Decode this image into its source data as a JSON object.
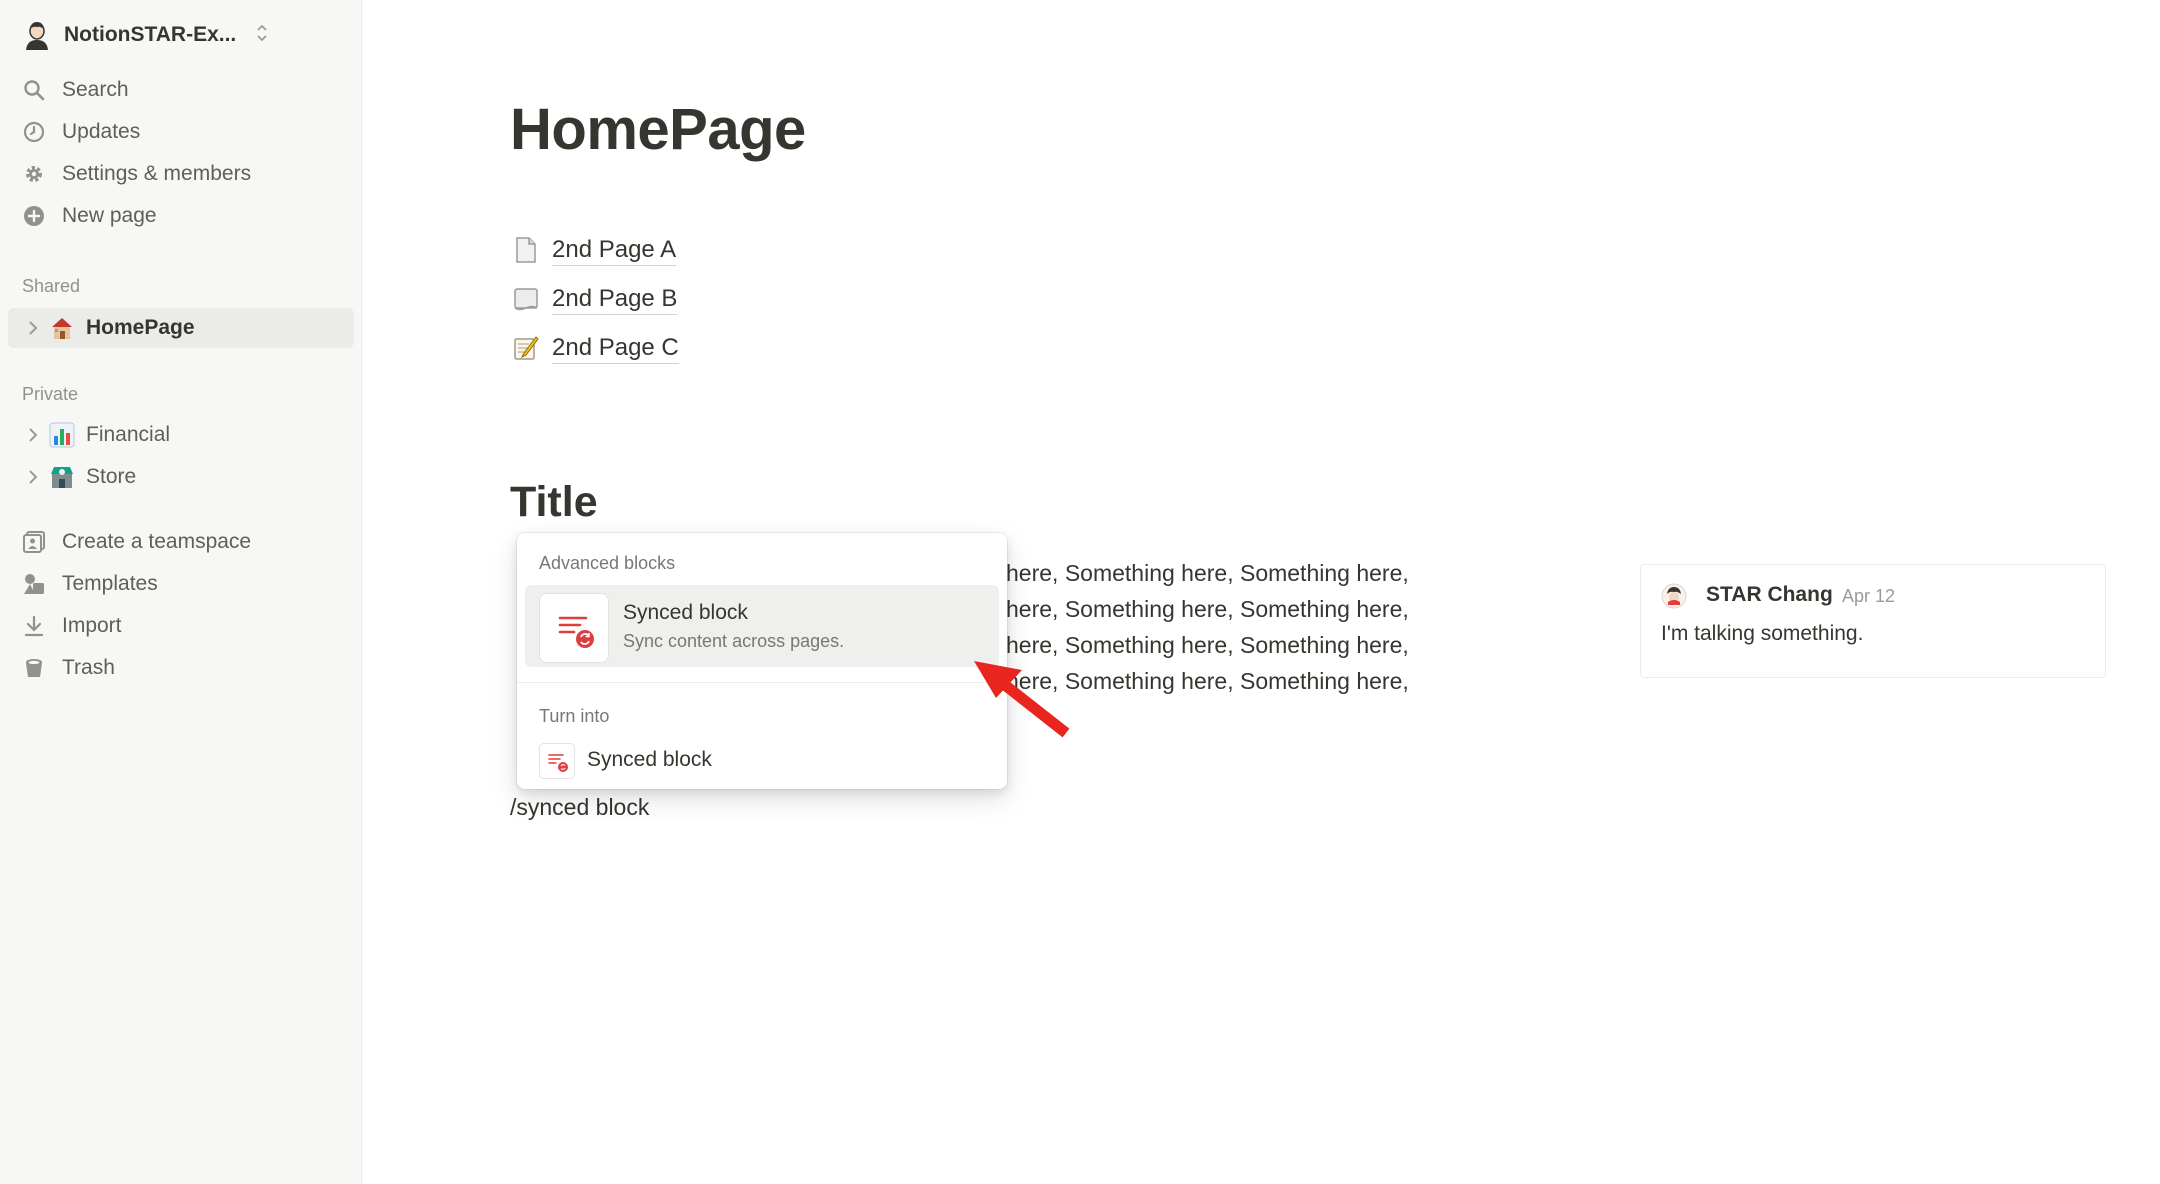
{
  "workspace": {
    "name": "NotionSTAR-Ex..."
  },
  "sidebar": {
    "top_items": [
      {
        "label": "Search",
        "icon": "search-icon"
      },
      {
        "label": "Updates",
        "icon": "clock-icon"
      },
      {
        "label": "Settings & members",
        "icon": "gear-icon"
      },
      {
        "label": "New page",
        "icon": "plus-circle-icon"
      }
    ],
    "shared_label": "Shared",
    "shared_items": [
      {
        "label": "HomePage",
        "icon": "house-icon"
      }
    ],
    "private_label": "Private",
    "private_items": [
      {
        "label": "Financial",
        "icon": "bar-chart-icon"
      },
      {
        "label": "Store",
        "icon": "store-icon"
      }
    ],
    "bottom_items": [
      {
        "label": "Create a teamspace",
        "icon": "teamspace-icon"
      },
      {
        "label": "Templates",
        "icon": "templates-icon"
      },
      {
        "label": "Import",
        "icon": "download-icon"
      },
      {
        "label": "Trash",
        "icon": "trash-icon"
      }
    ]
  },
  "page": {
    "title": "HomePage",
    "links": [
      {
        "label": "2nd Page A",
        "icon": "page-icon"
      },
      {
        "label": "2nd Page B",
        "icon": "scroll-icon"
      },
      {
        "label": "2nd Page C",
        "icon": "memo-icon"
      }
    ],
    "heading": "Title",
    "body_lines": [
      "here, Something here, Something here,",
      "here, Something here, Something here,",
      "here, Something here, Something here,",
      "here, Something here, Something here,"
    ],
    "slash_command": "/synced block"
  },
  "popup": {
    "section1": "Advanced blocks",
    "item_title": "Synced block",
    "item_desc": "Sync content across pages.",
    "section2": "Turn into",
    "turn_into_title": "Synced block"
  },
  "comment": {
    "author": "STAR Chang",
    "date": "Apr 12",
    "text": "I'm talking something."
  },
  "colors": {
    "accent_red": "#e03e3e",
    "sidebar_bg": "#f7f7f5"
  }
}
